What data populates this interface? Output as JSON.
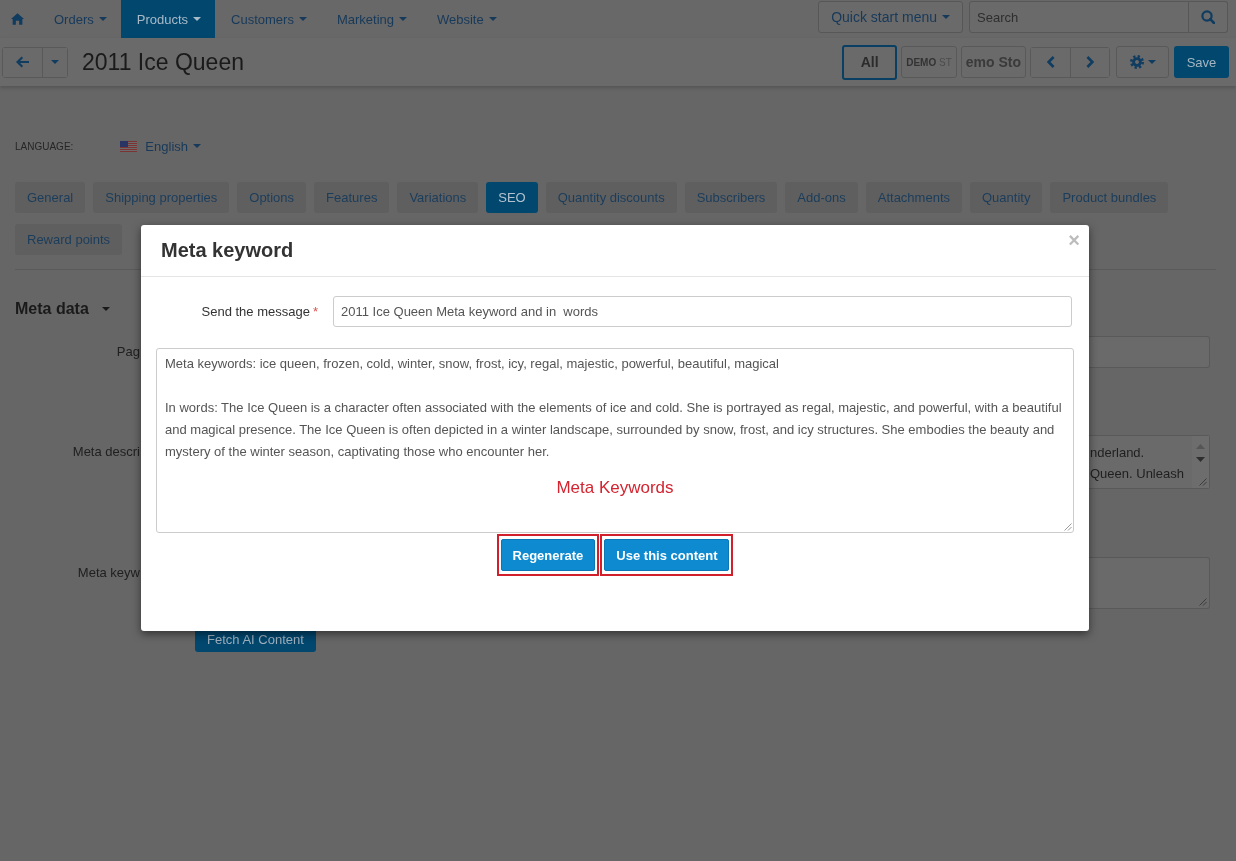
{
  "top_nav": {
    "menu": [
      {
        "label": "Orders",
        "selected": false
      },
      {
        "label": "Products",
        "selected": true
      },
      {
        "label": "Customers",
        "selected": false
      },
      {
        "label": "Marketing",
        "selected": false
      },
      {
        "label": "Website",
        "selected": false
      }
    ],
    "quick_start": "Quick start menu",
    "search": {
      "placeholder": "Search"
    }
  },
  "toolbar": {
    "title": "2011 Ice Queen",
    "stores": [
      {
        "label": "All",
        "kind": "text",
        "selected": true
      },
      {
        "label": "**DEMO** ST",
        "kind": "caption",
        "selected": false
      },
      {
        "label": "emo Sto",
        "kind": "wordmark",
        "selected": false
      }
    ],
    "save": "Save"
  },
  "language": {
    "label": "LANGUAGE:",
    "value": "English"
  },
  "tabs": [
    {
      "label": "General",
      "selected": false
    },
    {
      "label": "Shipping properties",
      "selected": false
    },
    {
      "label": "Options",
      "selected": false
    },
    {
      "label": "Features",
      "selected": false
    },
    {
      "label": "Variations",
      "selected": false
    },
    {
      "label": "SEO",
      "selected": true
    },
    {
      "label": "Quantity discounts",
      "selected": false
    },
    {
      "label": "Subscribers",
      "selected": false
    },
    {
      "label": "Add-ons",
      "selected": false
    },
    {
      "label": "Attachments",
      "selected": false
    },
    {
      "label": "Quantity",
      "selected": false
    },
    {
      "label": "Product bundles",
      "selected": false
    },
    {
      "label": "Reward points",
      "selected": false
    }
  ],
  "meta_data": {
    "title": "Meta data",
    "fields": [
      {
        "label": "Pag",
        "kind": "input"
      },
      {
        "label": "Meta descri",
        "kind": "textarea",
        "lines": [
          "nderland.",
          "Queen. Unleash"
        ]
      },
      {
        "label": "Meta keyw",
        "kind": "textarea"
      }
    ],
    "fetch_button": "Fetch AI Content"
  },
  "modal": {
    "title": "Meta keyword",
    "close": "×",
    "prompt": {
      "label": "Send the message",
      "required_mark": "*",
      "value": "2011 Ice Queen Meta keyword and in  words"
    },
    "content": "Meta keywords: ice queen, frozen, cold, winter, snow, frost, icy, regal, majestic, powerful, beautiful, magical\n\nIn words: The Ice Queen is a character often associated with the elements of ice and cold. She is portrayed as regal, majestic, and powerful, with a beautiful and magical presence. The Ice Queen is often depicted in a winter landscape, surrounded by snow, frost, and icy structures. She embodies the beauty and mystery of the winter season, captivating those who encounter her.",
    "annotation": "Meta Keywords",
    "buttons": [
      {
        "label": "Regenerate",
        "highlighted": true
      },
      {
        "label": "Use this content",
        "highlighted": true
      }
    ]
  }
}
